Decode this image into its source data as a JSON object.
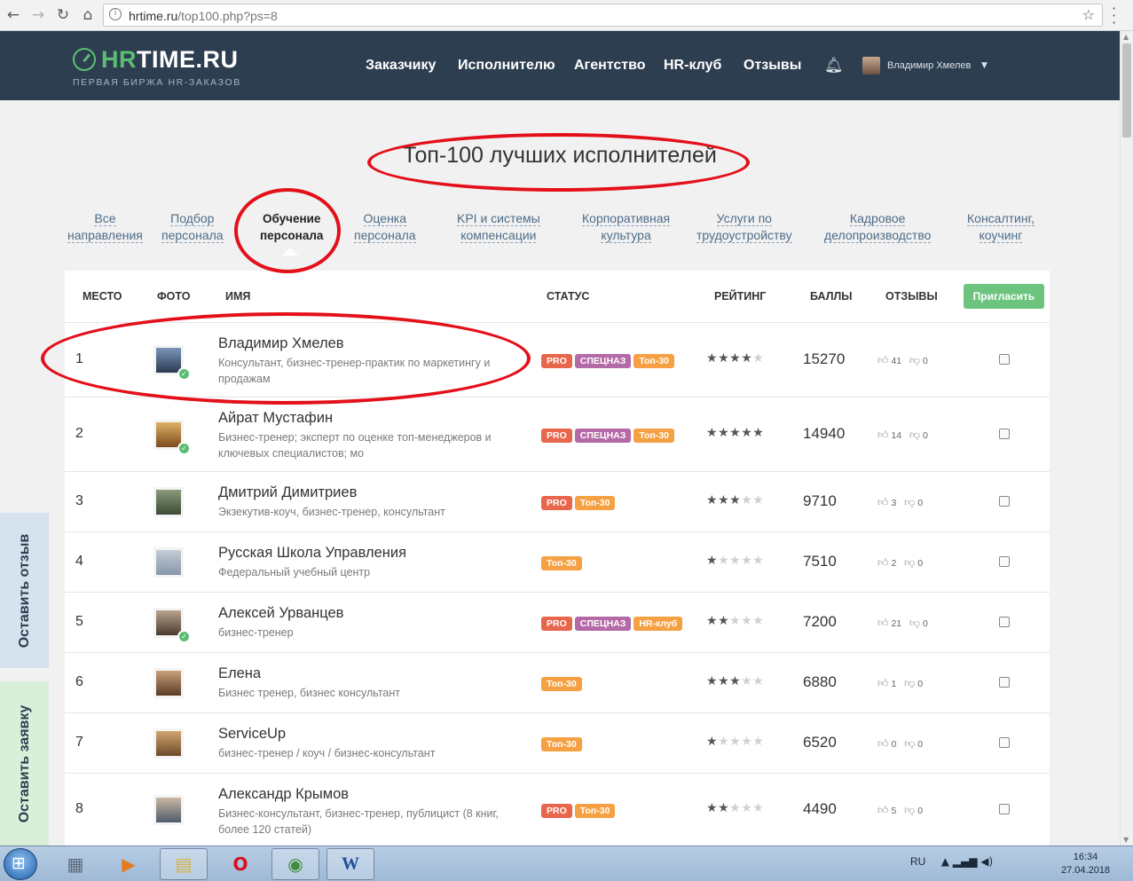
{
  "browser": {
    "back_icon": "arrow-left-icon",
    "forward_icon": "arrow-right-icon",
    "reload_icon": "reload-icon",
    "home_icon": "home-icon",
    "url_host": "hrtime.ru",
    "url_path": "/top100.php?ps=8"
  },
  "header": {
    "logo_hr": "HR",
    "logo_rest": "TIME.RU",
    "logo_sub": "ПЕРВАЯ БИРЖА HR-ЗАКАЗОВ",
    "nav": [
      "Заказчику",
      "Исполнителю",
      "Агентство",
      "HR-клуб",
      "Отзывы"
    ],
    "user_name": "Владимир Хмелев"
  },
  "page": {
    "title": "Топ-100 лучших исполнителей"
  },
  "categories": [
    {
      "line1": "Все",
      "line2": "направления",
      "active": false
    },
    {
      "line1": "Подбор",
      "line2": "персонала",
      "active": false
    },
    {
      "line1": "Обучение",
      "line2": "персонала",
      "active": true
    },
    {
      "line1": "Оценка",
      "line2": "персонала",
      "active": false
    },
    {
      "line1": "KPI и системы",
      "line2": "компенсации",
      "active": false
    },
    {
      "line1": "Корпоративная",
      "line2": "культура",
      "active": false
    },
    {
      "line1": "Услуги по",
      "line2": "трудоустройству",
      "active": false
    },
    {
      "line1": "Кадровое",
      "line2": "делопроизводство",
      "active": false
    },
    {
      "line1": "Консалтинг,",
      "line2": "коучинг",
      "active": false
    }
  ],
  "table": {
    "columns": {
      "rank": "МЕСТО",
      "photo": "ФОТО",
      "name": "ИМЯ",
      "status": "СТАТУС",
      "rating": "РЕЙТИНГ",
      "score": "БАЛЛЫ",
      "reviews": "ОТЗЫВЫ"
    },
    "invite_label": "Пригласить",
    "rows": [
      {
        "rank": "1",
        "name": "Владимир Хмелев",
        "desc": "Консультант, бизнес-тренер-практик по маркетингу и продажам",
        "badges": [
          "PRO",
          "СПЕЦНАЗ",
          "Топ-30"
        ],
        "stars": 4,
        "score": "15270",
        "likes": "41",
        "dislikes": "0",
        "verified": true
      },
      {
        "rank": "2",
        "name": "Айрат Мустафин",
        "desc": "Бизнес-тренер; эксперт по оценке топ-менеджеров и ключевых специалистов; мо",
        "badges": [
          "PRO",
          "СПЕЦНАЗ",
          "Топ-30"
        ],
        "stars": 5,
        "score": "14940",
        "likes": "14",
        "dislikes": "0",
        "verified": true
      },
      {
        "rank": "3",
        "name": "Дмитрий Димитриев",
        "desc": "Экзекутив-коуч, бизнес-тренер, консультант",
        "badges": [
          "PRO",
          "Топ-30"
        ],
        "stars": 3,
        "score": "9710",
        "likes": "3",
        "dislikes": "0",
        "verified": false
      },
      {
        "rank": "4",
        "name": "Русская Школа Управления",
        "desc": "Федеральный учебный центр",
        "badges": [
          "Топ-30"
        ],
        "stars": 1,
        "score": "7510",
        "likes": "2",
        "dislikes": "0",
        "verified": false
      },
      {
        "rank": "5",
        "name": "Алексей Урванцев",
        "desc": "бизнес-тренер",
        "badges": [
          "PRO",
          "СПЕЦНАЗ",
          "HR-клуб"
        ],
        "stars": 2,
        "score": "7200",
        "likes": "21",
        "dislikes": "0",
        "verified": true
      },
      {
        "rank": "6",
        "name": "Елена",
        "desc": "Бизнес тренер, бизнес консультант",
        "badges": [
          "Топ-30"
        ],
        "stars": 3,
        "score": "6880",
        "likes": "1",
        "dislikes": "0",
        "verified": false
      },
      {
        "rank": "7",
        "name": "ServiceUp",
        "desc": "бизнес-тренер / коуч / бизнес-консультант",
        "badges": [
          "Топ-30"
        ],
        "stars": 1,
        "score": "6520",
        "likes": "0",
        "dislikes": "0",
        "verified": false
      },
      {
        "rank": "8",
        "name": "Александр Крымов",
        "desc": "Бизнес-консультант, бизнес-тренер, публицист (8 книг, более 120 статей)",
        "badges": [
          "PRO",
          "Топ-30"
        ],
        "stars": 2,
        "score": "4490",
        "likes": "5",
        "dislikes": "0",
        "verified": false
      }
    ]
  },
  "side_tabs": {
    "review": "Оставить отзыв",
    "request": "Оставить заявку"
  },
  "colors": {
    "header_bg": "#2d3e50",
    "brand_green": "#5bbd72",
    "badge_pro": "#e8664c",
    "badge_specnaz": "#b46aa6",
    "badge_top30": "#f5a143",
    "annotation_red": "#e3101a"
  },
  "taskbar": {
    "lang": "RU",
    "time": "16:34",
    "date": "27.04.2018",
    "apps": [
      "calculator-icon",
      "media-player-icon",
      "file-explorer-icon",
      "opera-icon",
      "chrome-icon",
      "word-icon"
    ]
  }
}
